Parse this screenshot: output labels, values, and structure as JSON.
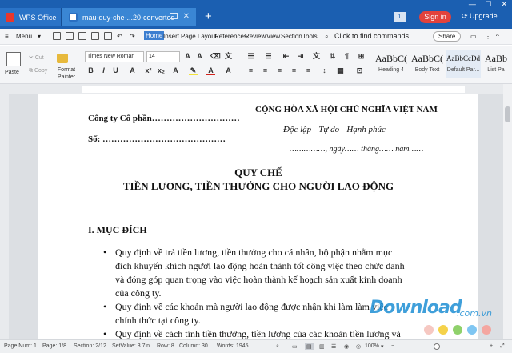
{
  "titlebar": {
    "app_tab": "WPS Office",
    "doc_tab": "mau-quy-che-...20-converted",
    "page_indicator": "1",
    "signin": "Sign in",
    "upgrade": "Upgrade"
  },
  "menubar": {
    "menu": "Menu",
    "items": [
      "Home",
      "Insert",
      "Page Layout",
      "References",
      "Review",
      "View",
      "Section",
      "Tools"
    ],
    "search": "Click to find commands",
    "share": "Share"
  },
  "ribbon": {
    "paste": "Paste",
    "cut": "Cut",
    "copy": "Copy",
    "format_painter": "Format Painter",
    "font": "Times New Roman",
    "size": "14",
    "styles": [
      {
        "sample": "AaBbC(",
        "label": "Heading 4"
      },
      {
        "sample": "AaBbC(",
        "label": "Body Text"
      },
      {
        "sample": "AaBbCcDd",
        "label": "Default Par..."
      },
      {
        "sample": "AaBb",
        "label": "List Pa"
      }
    ]
  },
  "document": {
    "company": "Công ty Cổ phần…………………………",
    "number": "Số: ……………………………………",
    "nation": "CỘNG HÒA XÃ HỘI CHỦ NGHĨA VIỆT NAM",
    "motto": "Độc lập - Tự do - Hạnh phúc",
    "date": "……………, ngày…… tháng…… năm……",
    "title1": "QUY CHẾ",
    "title2": "TIỀN LƯƠNG, TIỀN THƯỞNG CHO NGƯỜI LAO ĐỘNG",
    "section": "I. MỤC ĐÍCH",
    "lines": [
      "Quy định về trả tiền lương, tiền thưởng cho cá nhân, bộ phận nhằm mục",
      "đích khuyến khích người lao động hoàn thành tốt công việc theo chức danh",
      "và đóng góp quan trọng vào việc hoàn thành kế hoạch sản xuất kinh doanh",
      "của công ty.",
      "Quy định về các khoản mà người lao động được nhận khi làm làm việc",
      "chính thức tại công ty.",
      "Quy định về cách tính tiền thưởng, tiền lương của các khoản tiền lương và"
    ]
  },
  "statusbar": {
    "page_num": "Page Num: 1",
    "page": "Page: 1/8",
    "section": "Section: 2/12",
    "setvalue": "SetValue: 3.7in",
    "row": "Row: 8",
    "column": "Column: 30",
    "words": "Words: 1945",
    "zoom": "100% "
  },
  "watermark": {
    "text": "Download",
    "suffix": ".com.vn"
  }
}
